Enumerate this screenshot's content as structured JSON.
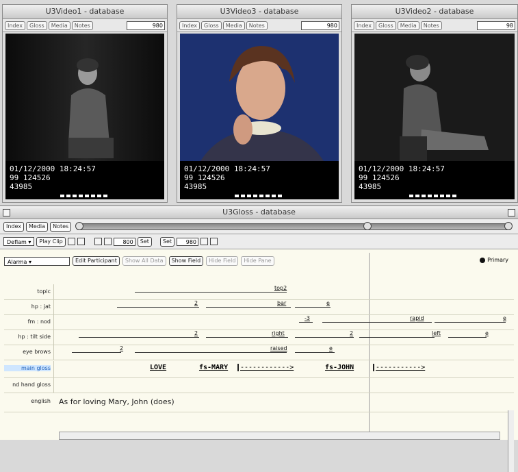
{
  "video_windows": [
    {
      "title": "U3Video1 - database",
      "buttons": [
        "Index",
        "Gloss",
        "Media",
        "Notes"
      ],
      "frame": "980",
      "tc_line1": "01/12/2000  18:24:57",
      "tc_line2": "99     124526",
      "tc_line3": "43985"
    },
    {
      "title": "U3Video3 - database",
      "buttons": [
        "Index",
        "Gloss",
        "Media",
        "Notes"
      ],
      "frame": "980",
      "tc_line1": "01/12/2000  18:24:57",
      "tc_line2": "99     124526",
      "tc_line3": "43985"
    },
    {
      "title": "U3Video2 - database",
      "buttons": [
        "Index",
        "Gloss",
        "Media",
        "Notes"
      ],
      "frame": "98",
      "tc_line1": "01/12/2000  18:24:57",
      "tc_line2": "99     124526",
      "tc_line3": "43985"
    }
  ],
  "gloss_window": {
    "title": "U3Gloss - database",
    "toolbar1": {
      "buttons": [
        "Index",
        "Media",
        "Notes"
      ]
    },
    "toolbar2": {
      "select": "Deflam",
      "play_clip": "Play Clip",
      "start_field": "800",
      "set1": "Set",
      "set2": "Set",
      "end_field": "980"
    },
    "tier_head": {
      "select": "Alarma",
      "buttons": [
        "Edit Participant",
        "Show All Data",
        "Show Field",
        "Hide Field",
        "Hide Pane"
      ],
      "primary_label": "Primary"
    },
    "tiers": [
      {
        "label": "topic",
        "segments": [
          {
            "text": "top2"
          }
        ]
      },
      {
        "label": "hp : jat",
        "segments": [
          {
            "text": "2"
          },
          {
            "text": "bar"
          },
          {
            "text": "e"
          }
        ]
      },
      {
        "label": "fm : nod",
        "segments": [
          {
            "text": "-3"
          },
          {
            "text": "rapid"
          },
          {
            "text": "e"
          }
        ]
      },
      {
        "label": "hp : tilt side",
        "segments": [
          {
            "text": "2"
          },
          {
            "text": "right"
          },
          {
            "text": "2"
          },
          {
            "text": "left"
          },
          {
            "text": "e"
          }
        ]
      },
      {
        "label": "eye brows",
        "segments": [
          {
            "text": "2"
          },
          {
            "text": "raised"
          },
          {
            "text": "e"
          }
        ]
      },
      {
        "label": "main gloss",
        "highlight": true
      },
      {
        "label": "nd hand gloss"
      },
      {
        "label": "english"
      }
    ],
    "main_gloss": {
      "w1": "LOVE",
      "w2": "fs-MARY",
      "a1": "------------>",
      "w3": "fs-JOHN",
      "a2": "----------->"
    },
    "english_text": "As for loving Mary, John (does)"
  },
  "colors": {
    "highlight": "#cfe6ff",
    "blue_text": "#1d5fb8"
  }
}
